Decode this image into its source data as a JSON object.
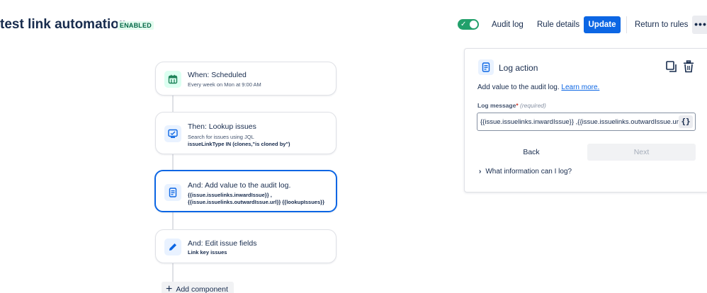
{
  "header": {
    "title": "test link automation",
    "status_badge": "ENABLED",
    "toggle_on": true,
    "buttons": {
      "audit_log": "Audit log",
      "rule_details": "Rule details",
      "update": "Update",
      "return_to_rules": "Return to rules",
      "more": "•••"
    }
  },
  "flow": {
    "components": [
      {
        "icon": "calendar-icon",
        "title": "When: Scheduled",
        "subtitle": "Every week on Mon at 9:00 AM"
      },
      {
        "icon": "search-issues-icon",
        "title": "Then: Lookup issues",
        "subtitle": "Search for issues using JQL",
        "subtitle_bold": "issueLinkType IN (clones,\"is cloned by\")"
      },
      {
        "icon": "log-document-icon",
        "title": "And: Add value to the audit log.",
        "subtitle_bold": "{{issue.issuelinks.inwardIssue}} ,",
        "subtitle_bold_2": "{{issue.issuelinks.outwardIssue.url}} {{lookupIssues}}",
        "selected": true
      },
      {
        "icon": "pencil-icon",
        "title": "And: Edit issue fields",
        "subtitle_bold": "Link key issues"
      }
    ],
    "add_component": "Add component"
  },
  "panel": {
    "icon": "log-document-icon",
    "title": "Log action",
    "description": "Add value to the audit log.",
    "learn_more": "Learn more.",
    "field_label": "Log message",
    "field_required_marker": "*",
    "field_required_note": "(required)",
    "field_value": "{{issue.issuelinks.inwardIssue}} ,{{issue.issuelinks.outwardIssue.url}} {{lookupIssues}}",
    "smart_value_button": "{}",
    "back": "Back",
    "next": "Next",
    "info_toggle": "What information can I log?"
  },
  "colors": {
    "accent": "#0c66e4",
    "toggle_on": "#22a06b",
    "badge_text": "#006644",
    "badge_bg": "#e3fcef"
  }
}
